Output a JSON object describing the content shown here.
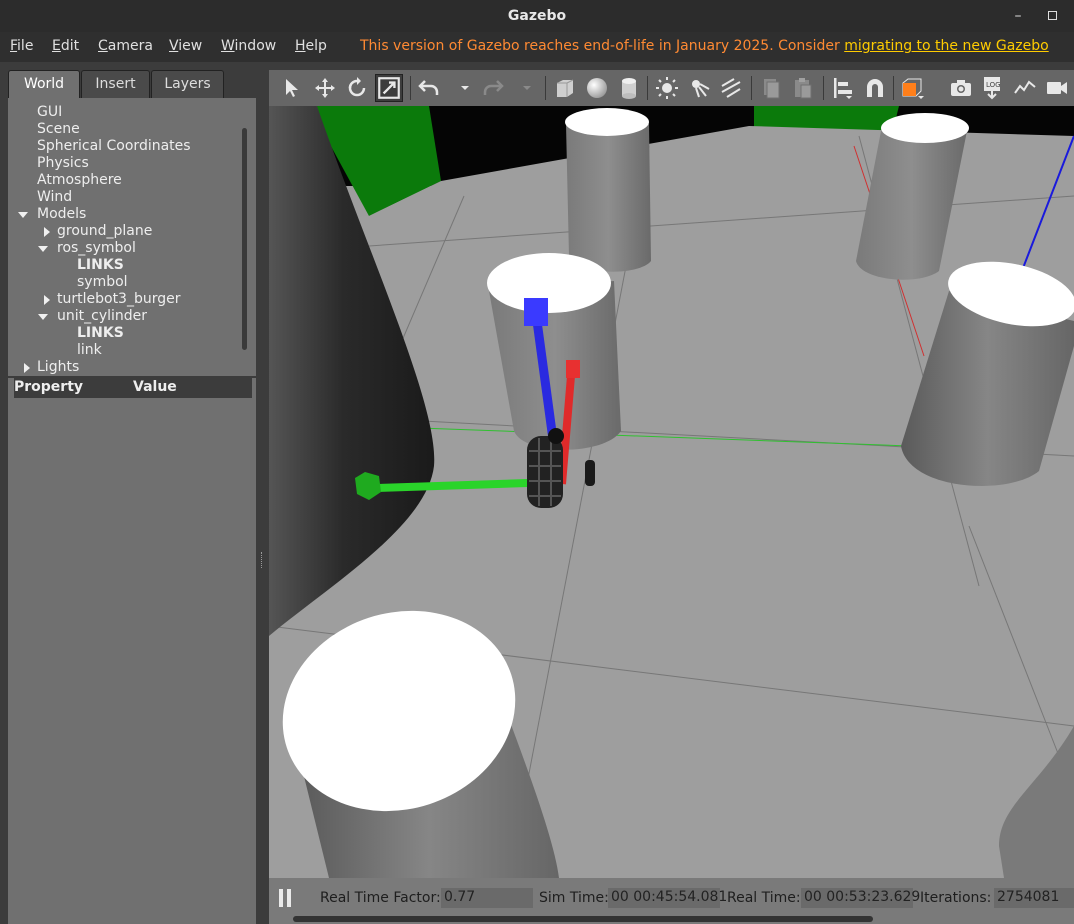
{
  "window": {
    "title": "Gazebo",
    "minimize_glyph": "–"
  },
  "menu": {
    "items": [
      {
        "label": "File",
        "mnemonic": "F",
        "rest": "ile"
      },
      {
        "label": "Edit",
        "mnemonic": "E",
        "rest": "dit"
      },
      {
        "label": "Camera",
        "mnemonic": "C",
        "rest": "amera"
      },
      {
        "label": "View",
        "mnemonic": "V",
        "rest": "iew"
      },
      {
        "label": "Window",
        "mnemonic": "W",
        "rest": "indow"
      },
      {
        "label": "Help",
        "mnemonic": "H",
        "rest": "elp"
      }
    ],
    "notice_text": "This version of Gazebo reaches end-of-life in January 2025. Consider ",
    "notice_link": "migrating to the new Gazebo"
  },
  "left_panel": {
    "tabs": [
      "World",
      "Insert",
      "Layers"
    ],
    "active_tab": "World",
    "tree": [
      {
        "label": "GUI"
      },
      {
        "label": "Scene"
      },
      {
        "label": "Spherical Coordinates"
      },
      {
        "label": "Physics"
      },
      {
        "label": "Atmosphere"
      },
      {
        "label": "Wind"
      },
      {
        "label": "Models"
      },
      {
        "label": "ground_plane"
      },
      {
        "label": "ros_symbol"
      },
      {
        "label": "LINKS"
      },
      {
        "label": "symbol"
      },
      {
        "label": "turtlebot3_burger"
      },
      {
        "label": "unit_cylinder"
      },
      {
        "label": "LINKS"
      },
      {
        "label": "link"
      },
      {
        "label": "Lights"
      }
    ],
    "property_header": {
      "property": "Property",
      "value": "Value"
    }
  },
  "toolbar": {
    "icons": [
      "select-arrow-icon",
      "translate-icon",
      "rotate-icon",
      "scale-icon",
      "undo-icon",
      "undo-history-icon",
      "redo-icon",
      "redo-history-icon",
      "box-shape-icon",
      "sphere-shape-icon",
      "cylinder-shape-icon",
      "point-light-icon",
      "spot-light-icon",
      "directional-light-icon",
      "copy-icon",
      "paste-icon",
      "align-icon",
      "snap-icon",
      "view-angle-icon",
      "screenshot-icon",
      "log-icon",
      "plot-icon",
      "video-record-icon"
    ]
  },
  "status": {
    "real_time_factor_label": "Real Time Factor:",
    "real_time_factor": "0.77",
    "sim_time_label": "Sim Time:",
    "sim_time": "00 00:45:54.081",
    "real_time_label": "Real Time:",
    "real_time": "00 00:53:23.629",
    "iterations_label": "Iterations:",
    "iterations": "2754081"
  },
  "colors": {
    "notice": "#ff8a33",
    "notice_link": "#ffcc00",
    "panel": "#707070",
    "ground": "#9d9d9d",
    "wall_green": "#0a7f0a",
    "axis_x": "#e02020",
    "axis_y": "#22cc22",
    "axis_z": "#2222ee"
  }
}
